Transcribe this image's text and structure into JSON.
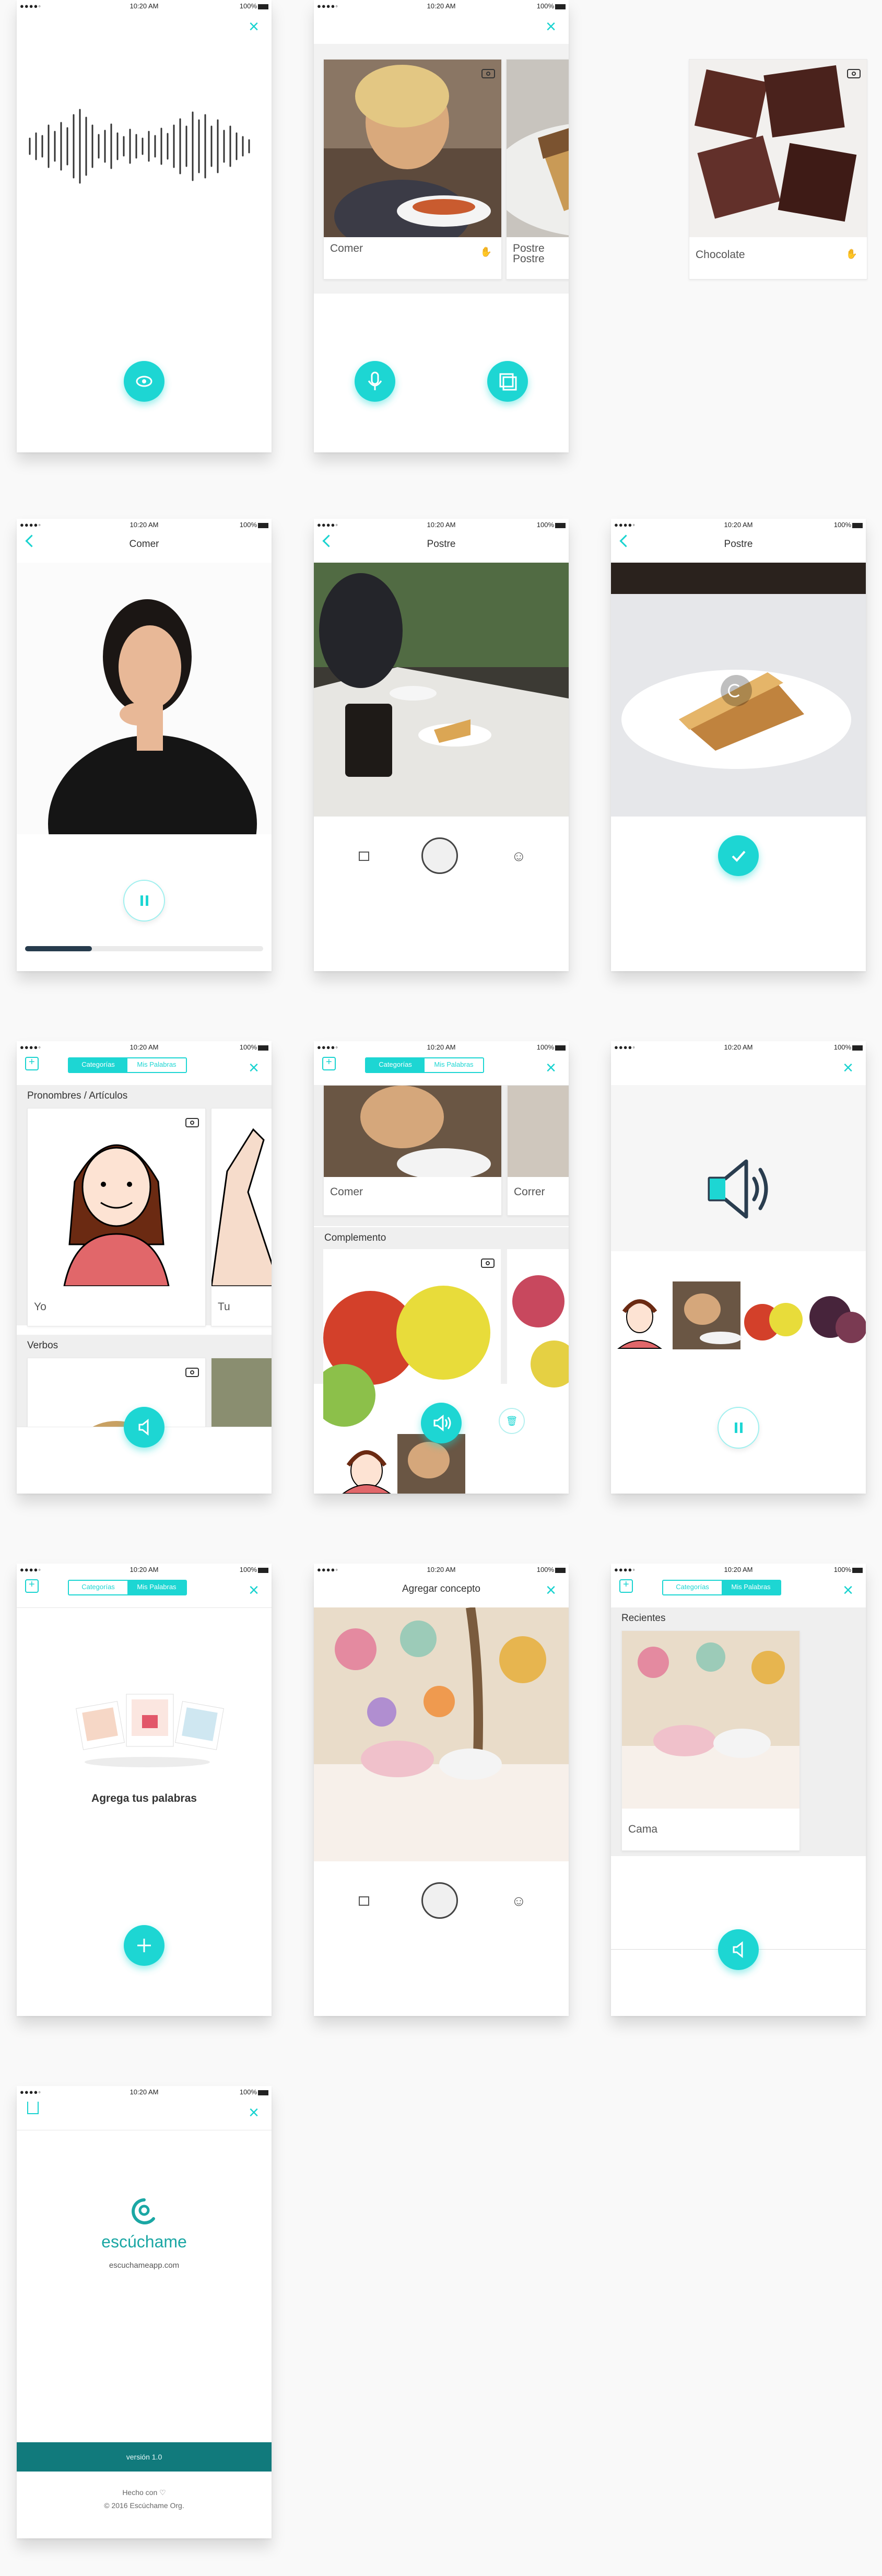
{
  "status": {
    "signal": "●●●●◦",
    "time": "10:20 AM",
    "battery": "100%"
  },
  "screen1": {
    "title": "",
    "fab_icon": "eye-icon"
  },
  "screen2": {
    "cards": [
      {
        "label": "Comer",
        "badge_icon": "hand-icon"
      },
      {
        "label": "Postre\nPostre",
        "badge_icon": ""
      },
      {
        "label": "Chocolate",
        "badge_icon": "hand-icon"
      }
    ],
    "fab_left_icon": "mic-icon",
    "fab_right_icon": "gallery-icon"
  },
  "screen3": {
    "title": "Comer",
    "progress": 0.28,
    "fab_icon": "pause-icon"
  },
  "screen4": {
    "title": "Postre"
  },
  "screen5": {
    "title": "Postre"
  },
  "screen6": {
    "tabs": [
      "Categorías",
      "Mis Palabras"
    ],
    "section1": "Pronombres / Artículos",
    "cards": [
      "Yo",
      "Tu"
    ],
    "section2": "Verbos"
  },
  "screen7": {
    "tabs": [
      "Categorías",
      "Mis Palabras"
    ],
    "cards": [
      "Comer",
      "Correr"
    ],
    "section2": "Complemento"
  },
  "screen8": {
    "speaker_icon": "speaker-icon"
  },
  "screen9": {
    "tabs": [
      "Categorías",
      "Mis Palabras"
    ],
    "empty_text": "Agrega tus palabras"
  },
  "screen10": {
    "title": "Agregar concepto"
  },
  "screen11": {
    "tabs": [
      "Categorías",
      "Mis Palabras"
    ],
    "section": "Recientes",
    "card": "Cama"
  },
  "screen12": {
    "brand": "escúchame",
    "url": "escuchameapp.com",
    "version": "versión 1.0",
    "made_with": "Hecho con ♡",
    "copyright": "© 2016 Escúchame Org."
  },
  "colors": {
    "accent": "#1dd6d3",
    "version_bar": "#117a7c"
  }
}
